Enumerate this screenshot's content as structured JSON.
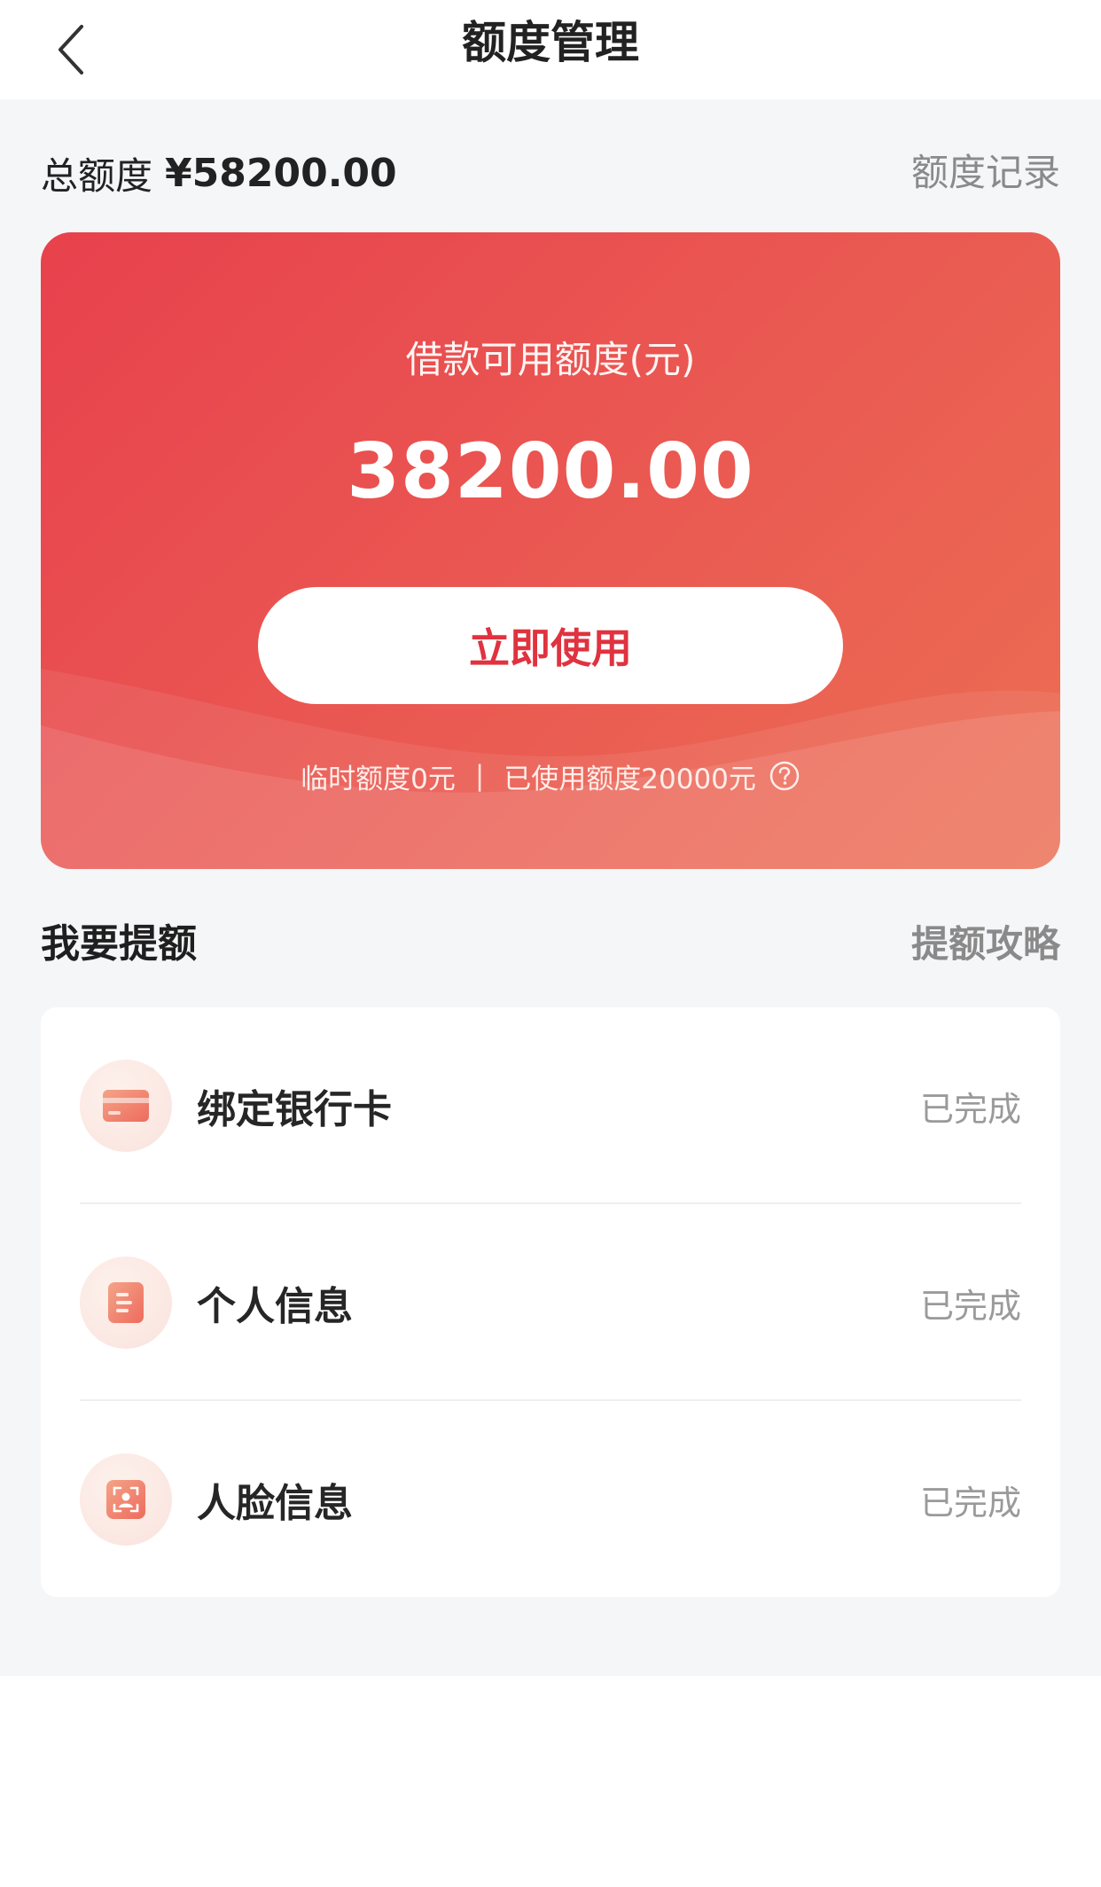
{
  "header": {
    "title": "额度管理"
  },
  "summary": {
    "total_label": "总额度",
    "total_amount": "¥58200.00",
    "record_link": "额度记录"
  },
  "credit": {
    "available_label": "借款可用额度(元)",
    "available_amount": "38200.00",
    "use_button": "立即使用",
    "temp_quota": "临时额度0元",
    "separator": "|",
    "used_quota": "已使用额度20000元"
  },
  "raise": {
    "title": "我要提额",
    "guide_link": "提额攻略",
    "tasks": [
      {
        "name": "绑定银行卡",
        "status": "已完成",
        "icon": "bank-card-icon"
      },
      {
        "name": "个人信息",
        "status": "已完成",
        "icon": "document-icon"
      },
      {
        "name": "人脸信息",
        "status": "已完成",
        "icon": "face-scan-icon"
      }
    ]
  },
  "colors": {
    "accent": "#e0323f",
    "card_start": "#e8414d",
    "card_end": "#ec6e52",
    "background": "#f5f6f8"
  }
}
